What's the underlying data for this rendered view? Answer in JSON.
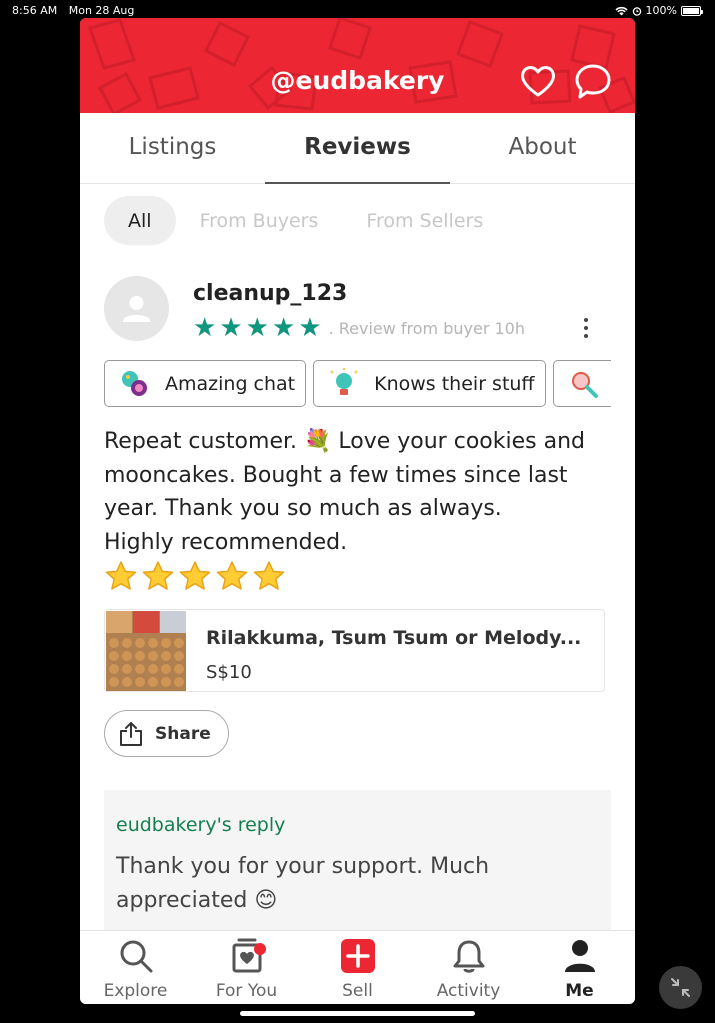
{
  "status_bar": {
    "time": "8:56 AM",
    "date": "Mon 28 Aug",
    "battery": "100%"
  },
  "header": {
    "title": "@eudbakery",
    "brand_color": "#ec2733",
    "icons": [
      "heart-icon",
      "chat-bubble-icon"
    ]
  },
  "tabs": [
    {
      "label": "Listings",
      "active": false
    },
    {
      "label": "Reviews",
      "active": true
    },
    {
      "label": "About",
      "active": false
    }
  ],
  "filters": [
    {
      "label": "All",
      "active": true
    },
    {
      "label": "From Buyers",
      "active": false
    },
    {
      "label": "From Sellers",
      "active": false
    }
  ],
  "review": {
    "username": "cleanup_123",
    "rating": 5,
    "rating_color": "#10957e",
    "meta": ". Review from buyer 10h",
    "badges": [
      {
        "label": "Amazing chat",
        "icon": "chat-badge-icon"
      },
      {
        "label": "Knows their stuff",
        "icon": "lightbulb-badge-icon"
      },
      {
        "label": "",
        "icon": "magnifier-badge-icon"
      }
    ],
    "text_lines": [
      "Repeat customer. 💐 Love your cookies and",
      "mooncakes. Bought a few times since last",
      "year. Thank you so much as always.",
      "Highly recommended."
    ],
    "emoji_stars": 5,
    "listing": {
      "title": "Rilakkuma, Tsum Tsum or Melody...",
      "price": "S$10"
    },
    "share_label": "Share"
  },
  "reply": {
    "label": "eudbakery's reply",
    "text": "Thank you for your support. Much appreciated 😊"
  },
  "bottom_nav": [
    {
      "label": "Explore",
      "icon": "search-icon",
      "active": false
    },
    {
      "label": "For You",
      "icon": "for-you-icon",
      "active": false,
      "notification_dot": true
    },
    {
      "label": "Sell",
      "icon": "sell-plus-icon",
      "active": false
    },
    {
      "label": "Activity",
      "icon": "bell-icon",
      "active": false
    },
    {
      "label": "Me",
      "icon": "profile-icon",
      "active": true
    }
  ]
}
